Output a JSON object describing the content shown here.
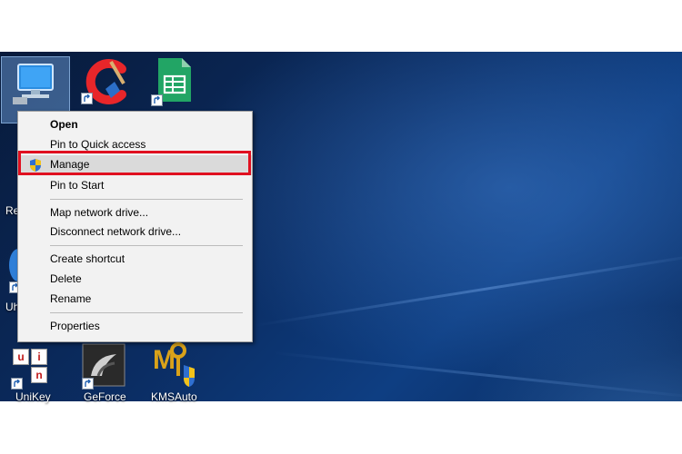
{
  "desktop": {
    "icons": [
      {
        "name": "This PC",
        "label": ""
      },
      {
        "name": "CCleaner",
        "label": ""
      },
      {
        "name": "Google Sheets",
        "label": ""
      },
      {
        "name": "UniKey",
        "label": "UniKey"
      },
      {
        "name": "GeForce",
        "label": "GeForce"
      },
      {
        "name": "KMSAuto",
        "label": "KMSAuto"
      }
    ],
    "partial_labels": {
      "recycle": "Re",
      "uh": "Uh"
    },
    "unikey_letters": [
      "u",
      "i",
      "n"
    ]
  },
  "context_menu": {
    "items": [
      {
        "label": "Open",
        "bold": true
      },
      {
        "label": "Pin to Quick access"
      },
      {
        "label": "Manage",
        "icon": "shield-icon",
        "highlighted": true
      },
      {
        "label": "Pin to Start"
      },
      {
        "label": "Map network drive..."
      },
      {
        "label": "Disconnect network drive..."
      },
      {
        "label": "Create shortcut"
      },
      {
        "label": "Delete"
      },
      {
        "label": "Rename"
      },
      {
        "label": "Properties"
      }
    ]
  },
  "colors": {
    "highlight_border": "#e01020",
    "menu_bg": "#f2f2f2"
  }
}
